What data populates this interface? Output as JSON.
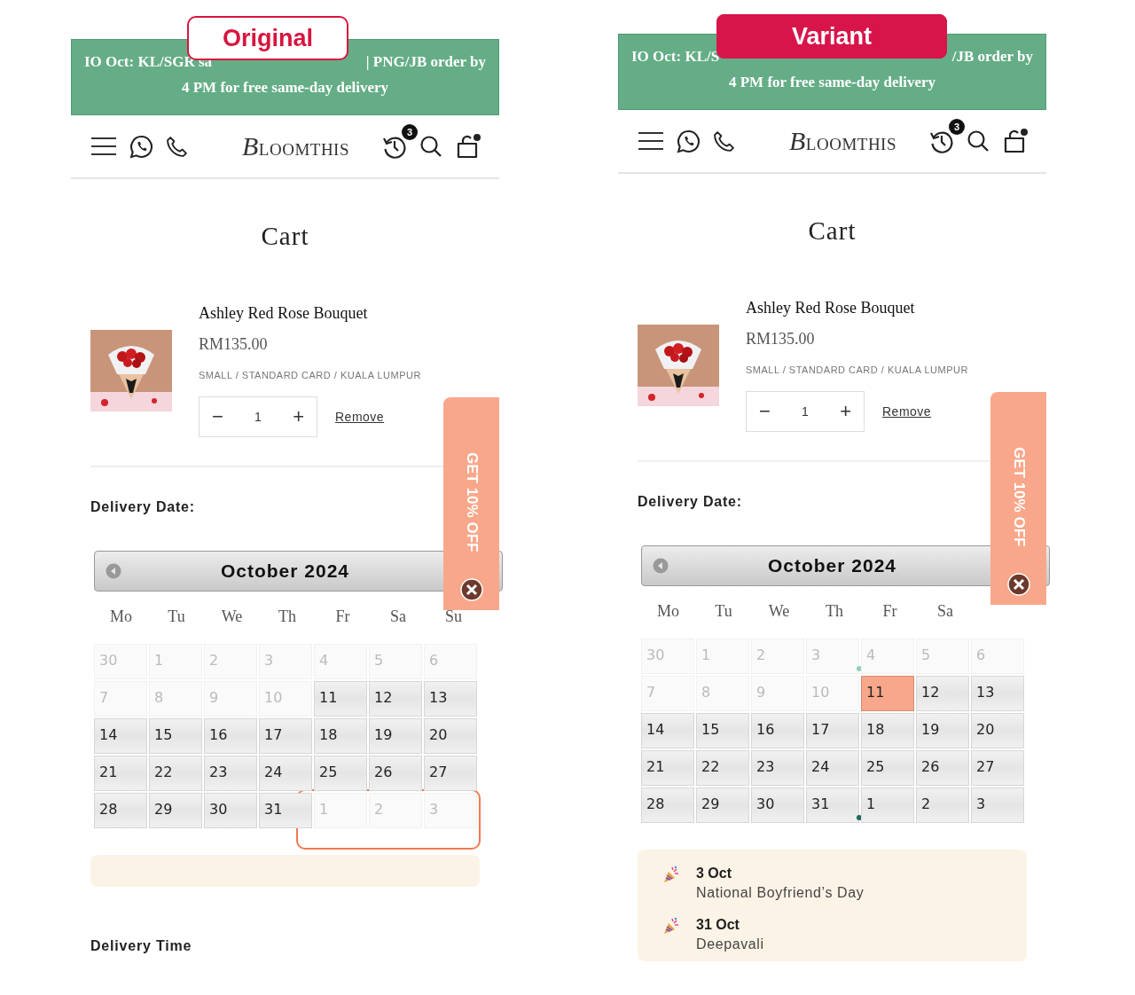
{
  "panels": [
    {
      "label": {
        "text": "Original",
        "kind": "outline"
      },
      "banner": {
        "line1_left": "IO Oct: KL/SGR sa",
        "line1_right": "| PNG/JB order by",
        "line2": "4 PM for free same-day delivery"
      },
      "header": {
        "logo": "BLOOMTHIS",
        "history_badge": "3"
      },
      "title": "Cart",
      "item": {
        "name": "Ashley Red Rose Bouquet",
        "price": "RM135.00",
        "variant": "SMALL / STANDARD CARD / KUALA LUMPUR",
        "minus": "−",
        "quantity": "1",
        "plus": "+",
        "remove": "Remove"
      },
      "delivery_date_label": "Delivery Date:",
      "calendar": {
        "month": "October 2024",
        "weekdays": [
          "Mo",
          "Tu",
          "We",
          "Th",
          "Fr",
          "Sa",
          "Su"
        ],
        "weeks": [
          [
            {
              "day": "30",
              "available": false,
              "selected": false
            },
            {
              "day": "1",
              "available": false,
              "selected": false
            },
            {
              "day": "2",
              "available": false,
              "selected": false
            },
            {
              "day": "3",
              "available": false,
              "selected": false
            },
            {
              "day": "4",
              "available": false,
              "selected": false
            },
            {
              "day": "5",
              "available": false,
              "selected": false
            },
            {
              "day": "6",
              "available": false,
              "selected": false
            }
          ],
          [
            {
              "day": "7",
              "available": false,
              "selected": false
            },
            {
              "day": "8",
              "available": false,
              "selected": false
            },
            {
              "day": "9",
              "available": false,
              "selected": false
            },
            {
              "day": "10",
              "available": false,
              "selected": false
            },
            {
              "day": "11",
              "available": true,
              "selected": false
            },
            {
              "day": "12",
              "available": true,
              "selected": false
            },
            {
              "day": "13",
              "available": true,
              "selected": false
            }
          ],
          [
            {
              "day": "14",
              "available": true,
              "selected": false
            },
            {
              "day": "15",
              "available": true,
              "selected": false
            },
            {
              "day": "16",
              "available": true,
              "selected": false
            },
            {
              "day": "17",
              "available": true,
              "selected": false
            },
            {
              "day": "18",
              "available": true,
              "selected": false
            },
            {
              "day": "19",
              "available": true,
              "selected": false
            },
            {
              "day": "20",
              "available": true,
              "selected": false
            }
          ],
          [
            {
              "day": "21",
              "available": true,
              "selected": false
            },
            {
              "day": "22",
              "available": true,
              "selected": false
            },
            {
              "day": "23",
              "available": true,
              "selected": false
            },
            {
              "day": "24",
              "available": true,
              "selected": false
            },
            {
              "day": "25",
              "available": true,
              "selected": false
            },
            {
              "day": "26",
              "available": true,
              "selected": false
            },
            {
              "day": "27",
              "available": true,
              "selected": false
            }
          ],
          [
            {
              "day": "28",
              "available": true,
              "selected": false
            },
            {
              "day": "29",
              "available": true,
              "selected": false
            },
            {
              "day": "30",
              "available": true,
              "selected": false
            },
            {
              "day": "31",
              "available": true,
              "selected": false
            },
            {
              "day": "1",
              "available": false,
              "selected": false,
              "circled": true
            },
            {
              "day": "2",
              "available": false,
              "selected": false,
              "circled": true
            },
            {
              "day": "3",
              "available": false,
              "selected": false,
              "circled": true
            }
          ]
        ]
      },
      "promo": {
        "text": "GET 10% OFF"
      },
      "delivery_time_label": "Delivery Time"
    },
    {
      "label": {
        "text": "Variant",
        "kind": "filled"
      },
      "banner": {
        "line1_left": "IO Oct: KL/S",
        "line1_right": "/JB order by",
        "line2": "4 PM for free same-day delivery"
      },
      "header": {
        "logo": "BLOOMTHIS",
        "history_badge": "3"
      },
      "title": "Cart",
      "item": {
        "name": "Ashley Red Rose Bouquet",
        "price": "RM135.00",
        "variant": "SMALL / STANDARD CARD / KUALA LUMPUR",
        "minus": "−",
        "quantity": "1",
        "plus": "+",
        "remove": "Remove"
      },
      "delivery_date_label": "Delivery Date:",
      "calendar": {
        "month": "October 2024",
        "weekdays": [
          "Mo",
          "Tu",
          "We",
          "Th",
          "Fr",
          "Sa"
        ],
        "weeks": [
          [
            {
              "day": "30",
              "available": false,
              "selected": false
            },
            {
              "day": "1",
              "available": false,
              "selected": false
            },
            {
              "day": "2",
              "available": false,
              "selected": false
            },
            {
              "day": "3",
              "available": false,
              "selected": false,
              "color": "#8fd0c0"
            },
            {
              "day": "4",
              "available": false,
              "selected": false
            },
            {
              "day": "5",
              "available": false,
              "selected": false
            },
            {
              "day": "6",
              "available": false,
              "selected": false
            }
          ],
          [
            {
              "day": "7",
              "available": false,
              "selected": false
            },
            {
              "day": "8",
              "available": false,
              "selected": false
            },
            {
              "day": "9",
              "available": false,
              "selected": false
            },
            {
              "day": "10",
              "available": false,
              "selected": false
            },
            {
              "day": "11",
              "available": true,
              "selected": true
            },
            {
              "day": "12",
              "available": true,
              "selected": false
            },
            {
              "day": "13",
              "available": true,
              "selected": false
            }
          ],
          [
            {
              "day": "14",
              "available": true,
              "selected": false
            },
            {
              "day": "15",
              "available": true,
              "selected": false
            },
            {
              "day": "16",
              "available": true,
              "selected": false
            },
            {
              "day": "17",
              "available": true,
              "selected": false
            },
            {
              "day": "18",
              "available": true,
              "selected": false
            },
            {
              "day": "19",
              "available": true,
              "selected": false
            },
            {
              "day": "20",
              "available": true,
              "selected": false
            }
          ],
          [
            {
              "day": "21",
              "available": true,
              "selected": false
            },
            {
              "day": "22",
              "available": true,
              "selected": false
            },
            {
              "day": "23",
              "available": true,
              "selected": false
            },
            {
              "day": "24",
              "available": true,
              "selected": false
            },
            {
              "day": "25",
              "available": true,
              "selected": false
            },
            {
              "day": "26",
              "available": true,
              "selected": false
            },
            {
              "day": "27",
              "available": true,
              "selected": false
            }
          ],
          [
            {
              "day": "28",
              "available": true,
              "selected": false
            },
            {
              "day": "29",
              "available": true,
              "selected": false
            },
            {
              "day": "30",
              "available": true,
              "selected": false
            },
            {
              "day": "31",
              "available": true,
              "selected": false,
              "color": "#1d6b57"
            },
            {
              "day": "1",
              "available": true,
              "selected": false
            },
            {
              "day": "2",
              "available": true,
              "selected": false
            },
            {
              "day": "3",
              "available": true,
              "selected": false
            }
          ]
        ]
      },
      "promo": {
        "text": "GET 10% OFF"
      },
      "holidays": [
        {
          "date": "3 Oct",
          "name": "National Boyfriend’s Day"
        },
        {
          "date": "31 Oct",
          "name": "Deepavali"
        }
      ]
    }
  ]
}
